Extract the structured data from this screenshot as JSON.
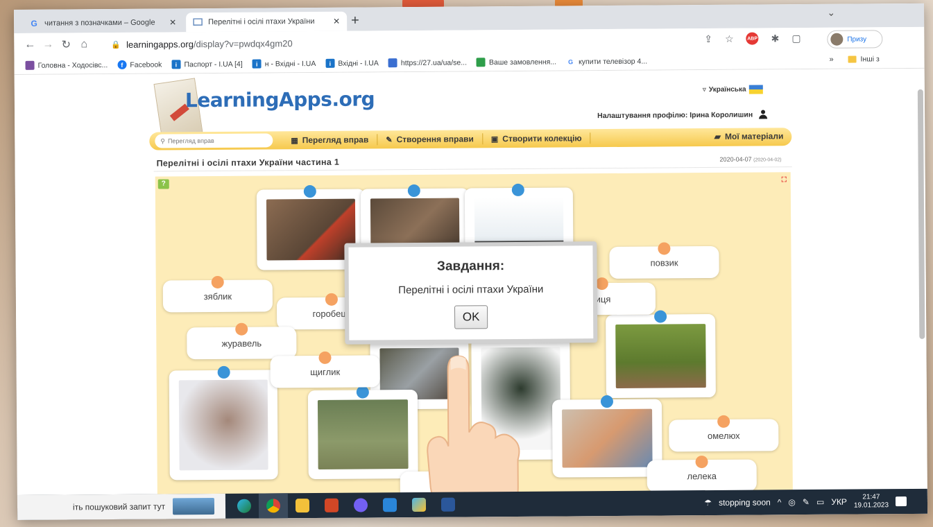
{
  "tabs": [
    {
      "title": "читання з позначками – Google",
      "favicon": "google-icon"
    },
    {
      "title": "Перелітні і осілі птахи України",
      "favicon": "learningapps-icon"
    }
  ],
  "address": {
    "host": "learningapps.org",
    "path": "/display?v=pwdqx4gm20"
  },
  "profile_label": "Призу",
  "bookmarks": [
    {
      "label": "Головна - Ходосівс...",
      "icon_color": "#7b4fa0"
    },
    {
      "label": "Facebook",
      "icon_color": "#1877f2"
    },
    {
      "label": "Паспорт - I.UA [4]",
      "icon_color": "#1a73c8"
    },
    {
      "label": "н - Вхідні - I.UA",
      "icon_color": "#1a73c8"
    },
    {
      "label": "Вхідні - I.UA",
      "icon_color": "#1a73c8"
    },
    {
      "label": "https://27.ua/ua/se...",
      "icon_color": "#3b6fd1"
    },
    {
      "label": "Ваше замовлення...",
      "icon_color": "#2e9e4a"
    },
    {
      "label": "купити телевізор 4...",
      "icon_color": "#4285f4"
    }
  ],
  "bookmarks_more": "»",
  "bookmarks_other": "Інші з",
  "site": {
    "logo": "LearningApps.org",
    "language": "Українська",
    "profile": "Налаштування профілю: Ірина Королишин",
    "search_placeholder": "Перегляд вправ",
    "nav": [
      "Перегляд вправ",
      "Створення вправи",
      "Створити колекцію"
    ],
    "my_materials": "Мої матеріали",
    "exercise_title": "Перелітні і осілі птахи України частина 1",
    "date": "2020-04-07",
    "date_small": "(2020-04-02)"
  },
  "words": [
    "повзик",
    "зяблик",
    "горобець",
    "ниця",
    "журавель",
    "щиглик",
    "омелюх",
    "лелека"
  ],
  "modal": {
    "title": "Завдання:",
    "text": "Перелітні і осілі птахи України",
    "button": "OK"
  },
  "taskbar": {
    "search": "іть пошуковий запит тут",
    "weather": "stopping soon",
    "lang": "УКР",
    "time": "21:47",
    "date": "19.01.2023"
  }
}
